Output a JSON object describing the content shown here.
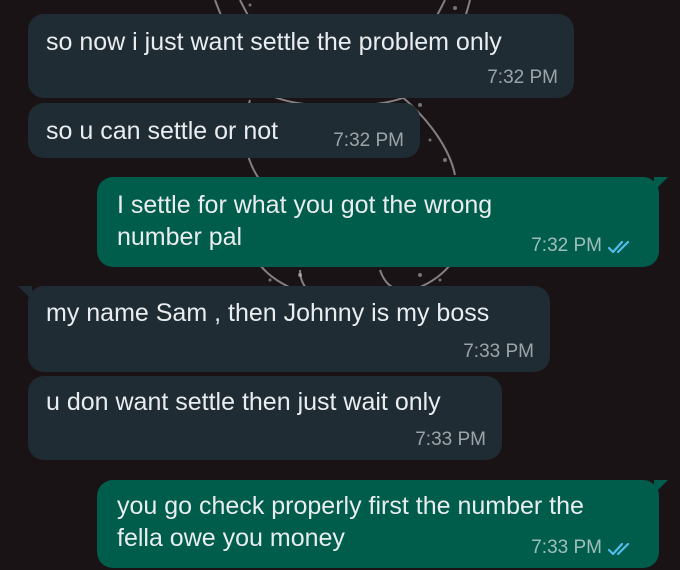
{
  "chat": {
    "messages": [
      {
        "direction": "incoming",
        "text_lines": [
          "so now i just want settle the problem only"
        ],
        "time": "7:32 PM"
      },
      {
        "direction": "incoming",
        "text_lines": [
          "so u can settle or not"
        ],
        "time": "7:32 PM"
      },
      {
        "direction": "outgoing",
        "text_lines": [
          "I settle for what you got the wrong",
          "number pal"
        ],
        "time": "7:32 PM",
        "status": "read"
      },
      {
        "direction": "incoming",
        "text_lines": [
          "my name Sam , then Johnny is my boss"
        ],
        "time": "7:33 PM"
      },
      {
        "direction": "incoming",
        "text_lines": [
          "u don want settle then just wait only"
        ],
        "time": "7:33 PM"
      },
      {
        "direction": "outgoing",
        "text_lines": [
          "you go check properly first the number the",
          "fella owe you money"
        ],
        "time": "7:33 PM",
        "status": "read"
      }
    ]
  },
  "colors": {
    "incoming_bubble": "#1f2c33",
    "outgoing_bubble": "#005c4b",
    "read_tick": "#53bdeb",
    "text": "#e9edef",
    "background": "#1a1316"
  },
  "icons": {
    "read_receipt": "double-check-icon"
  }
}
